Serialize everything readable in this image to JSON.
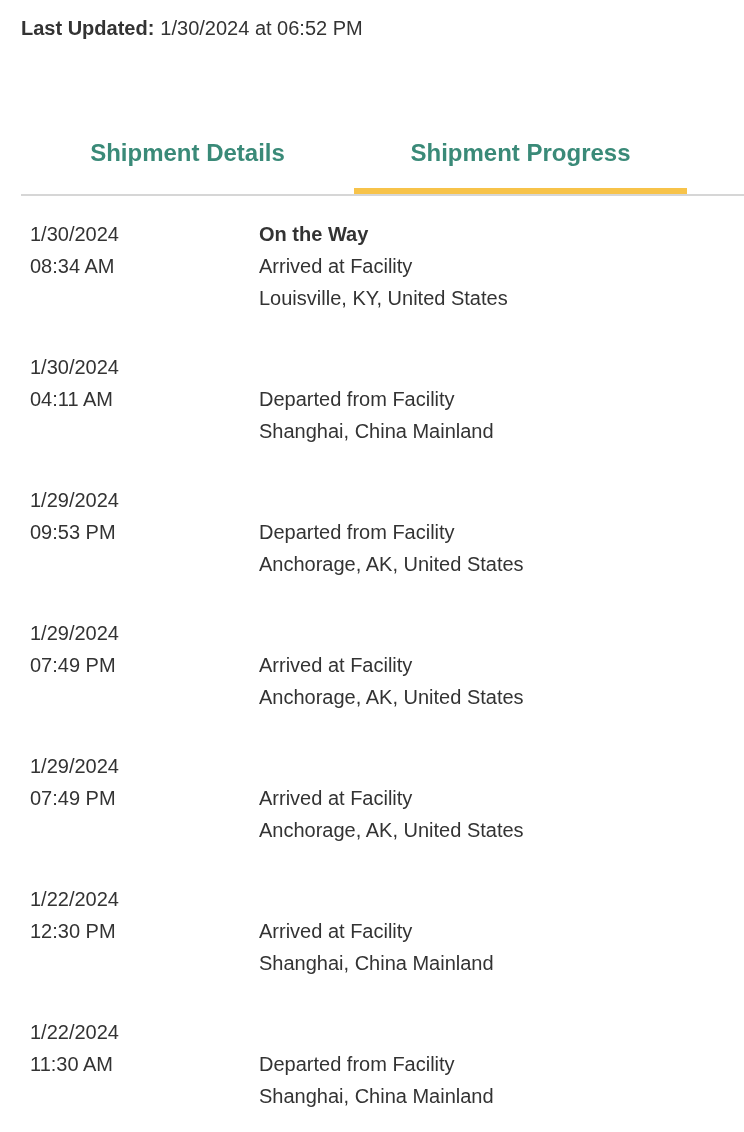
{
  "last_updated": {
    "label": "Last Updated:",
    "value": "1/30/2024 at 06:52 PM"
  },
  "tabs": [
    {
      "label": "Shipment Details",
      "selected": false
    },
    {
      "label": "Shipment Progress",
      "selected": true
    }
  ],
  "events": [
    {
      "date": "1/30/2024",
      "time": "08:34 AM",
      "status": "On the Way",
      "activity": "Arrived at Facility",
      "location": "Louisville, KY, United States"
    },
    {
      "date": "1/30/2024",
      "time": "04:11 AM",
      "activity": "Departed from Facility",
      "location": "Shanghai, China Mainland"
    },
    {
      "date": "1/29/2024",
      "time": "09:53 PM",
      "activity": "Departed from Facility",
      "location": "Anchorage, AK, United States"
    },
    {
      "date": "1/29/2024",
      "time": "07:49 PM",
      "activity": "Arrived at Facility",
      "location": "Anchorage, AK, United States"
    },
    {
      "date": "1/29/2024",
      "time": "07:49 PM",
      "activity": "Arrived at Facility",
      "location": "Anchorage, AK, United States"
    },
    {
      "date": "1/22/2024",
      "time": "12:30 PM",
      "activity": "Arrived at Facility",
      "location": "Shanghai, China Mainland"
    },
    {
      "date": "1/22/2024",
      "time": "11:30 AM",
      "activity": "Departed from Facility",
      "location": "Shanghai, China Mainland"
    }
  ]
}
